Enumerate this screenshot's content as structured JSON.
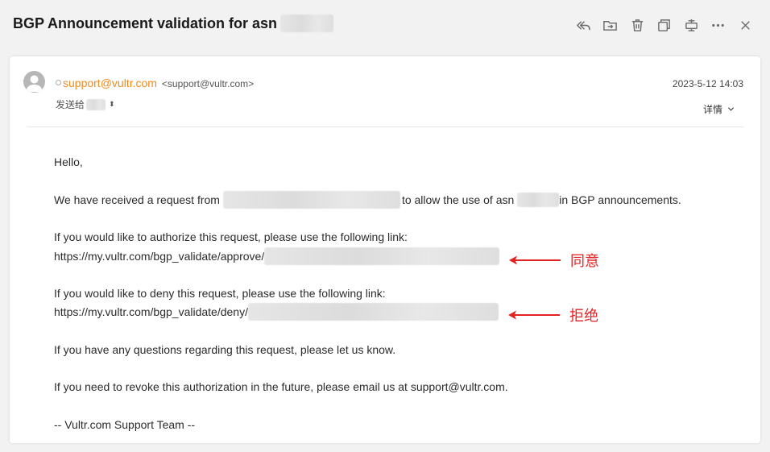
{
  "header": {
    "subject": "BGP Announcement validation for asn"
  },
  "toolbar": {
    "icons": [
      "reply-all-icon",
      "move-folder-icon",
      "trash-icon",
      "new-window-icon",
      "print-icon",
      "more-icon",
      "close-icon"
    ]
  },
  "message": {
    "sender_name": "support@vultr.com",
    "sender_address": "<support@vultr.com>",
    "date": "2023-5-12 14:03",
    "to_label": "发送给",
    "details_label": "详情"
  },
  "body": {
    "greeting": "Hello,",
    "received_prefix": "We have received a request from",
    "received_middle": "to allow the use of asn",
    "received_suffix": "in BGP announcements.",
    "authorize_intro": "If you would like to authorize this request, please use the following link:",
    "approve_link": "https://my.vultr.com/bgp_validate/approve/",
    "deny_intro": "If you would like to deny this request, please use the following link:",
    "deny_link": "https://my.vultr.com/bgp_validate/deny/",
    "questions": "If you have any questions regarding this request, please let us know.",
    "revoke": "If you need to revoke this authorization in the future, please email us at support@vultr.com.",
    "signature": "-- Vultr.com Support Team --"
  },
  "annotations": {
    "agree_label": "同意",
    "refuse_label": "拒绝",
    "color": "#e52222"
  },
  "colors": {
    "sender": "#ef8a1e",
    "background": "#f2f2f2",
    "card": "#ffffff"
  }
}
